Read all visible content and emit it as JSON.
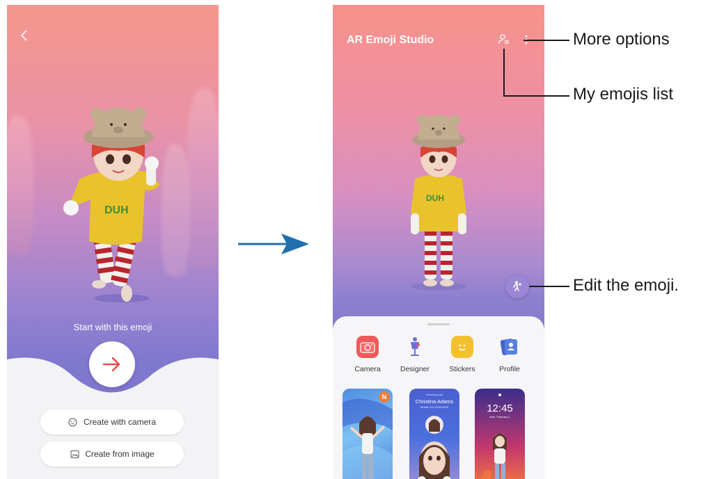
{
  "left_screen": {
    "back_icon": "chevron-left-icon",
    "start_label": "Start with this emoji",
    "go_icon": "arrow-right-icon",
    "create_with_camera": "Create with camera",
    "create_from_image": "Create from image"
  },
  "right_screen": {
    "app_title": "AR Emoji Studio",
    "tools": [
      {
        "label": "Camera",
        "icon": "camera-icon"
      },
      {
        "label": "Designer",
        "icon": "mannequin-icon"
      },
      {
        "label": "Stickers",
        "icon": "sticker-icon"
      },
      {
        "label": "Profile",
        "icon": "profile-card-icon"
      }
    ],
    "thumb_badge": "N",
    "call_label": "Incoming call",
    "caller_name": "Christina Adams",
    "caller_sub": "Mobile 010-1234-5678",
    "lock_time": "12:45",
    "lock_date": "Mon, February 1"
  },
  "callouts": {
    "more_options": "More options",
    "my_emojis_list": "My emojis list",
    "edit_the_emoji": "Edit the emoji."
  },
  "colors": {
    "arrow": "#1f6fae",
    "go_arrow": "#e84c4c",
    "edit_fab": "#9a86d4"
  }
}
